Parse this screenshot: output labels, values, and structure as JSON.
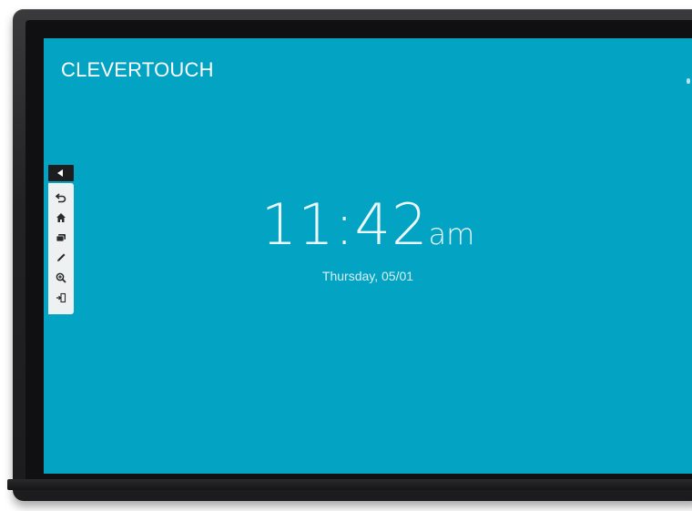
{
  "brand": "CLEVERTOUCH",
  "clock": {
    "time": "11:42",
    "period": "am",
    "date": "Thursday, 05/01"
  },
  "toolbar": {
    "collapse_icon": "triangle-left-icon",
    "tools": [
      {
        "name": "back",
        "icon": "undo-arrow-icon"
      },
      {
        "name": "home",
        "icon": "home-icon"
      },
      {
        "name": "windows",
        "icon": "stacked-windows-icon"
      },
      {
        "name": "annotate",
        "icon": "pen-icon"
      },
      {
        "name": "zoom",
        "icon": "zoom-in-icon"
      },
      {
        "name": "exit",
        "icon": "exit-icon"
      }
    ]
  },
  "colors": {
    "screen": "#03a3c4",
    "bezel": "#222224",
    "toolbar": "#eef1f2",
    "icon": "#2a2a2a"
  }
}
